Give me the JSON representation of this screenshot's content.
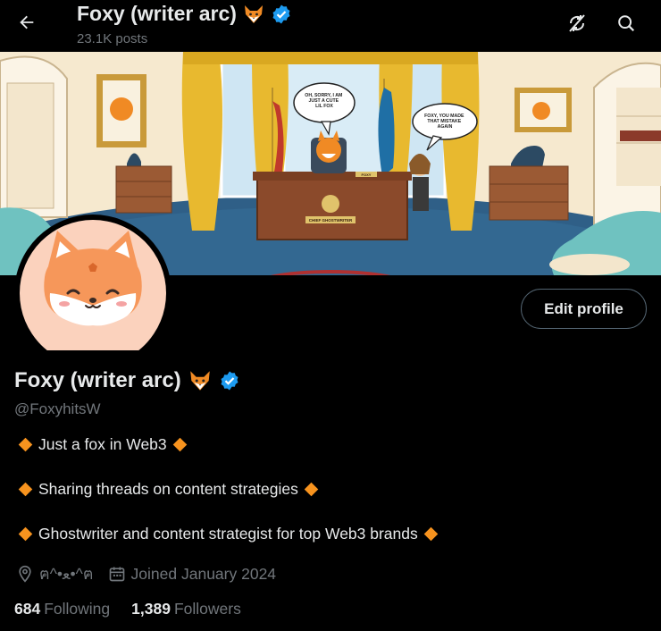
{
  "header": {
    "display_name": "Foxy (writer arc) ",
    "post_count": "23.1K posts",
    "back_icon": "arrow-left-icon",
    "refresh_icon": "refresh-off-icon",
    "search_icon": "search-icon"
  },
  "banner": {
    "bubble_left": "OH, SORRY, I AM JUST A CUTE LIL FOX",
    "bubble_right": "FOXY, YOU MADE THAT MISTAKE AGAIN",
    "desk_plaque": "CHIEF GHOSTWRITER",
    "name_plate": "FOXY"
  },
  "profile": {
    "edit_button": "Edit profile",
    "display_name": "Foxy (writer arc) ",
    "handle": "@FoxyhitsW",
    "verified_icon": "verified-badge-icon",
    "fox_emoji": "🦊",
    "bio": [
      "Just a fox in Web3",
      "Sharing threads on content strategies",
      "Ghostwriter and content strategist for top Web3 brands"
    ],
    "location": "ฅ^•ﻌ•^ฅ",
    "joined": "Joined January 2024",
    "following_count": "684",
    "following_label": "Following",
    "followers_count": "1,389",
    "followers_label": "Followers"
  },
  "colors": {
    "accent_orange": "#f7931e",
    "verified_blue": "#1d9bf0",
    "muted": "#71767b"
  }
}
